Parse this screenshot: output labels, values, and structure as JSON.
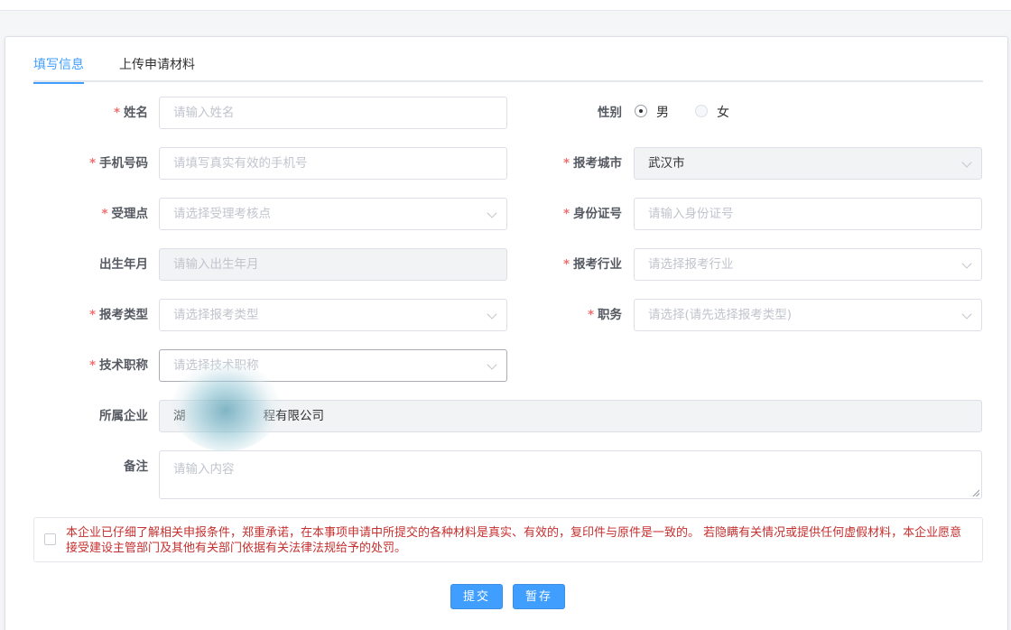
{
  "tabs": [
    {
      "label": "填写信息",
      "active": true
    },
    {
      "label": "上传申请材料",
      "active": false
    }
  ],
  "form": {
    "name": {
      "label": "姓名",
      "required": true,
      "placeholder": "请输入姓名"
    },
    "gender": {
      "label": "性别",
      "options": [
        "男",
        "女"
      ],
      "selected": "男"
    },
    "phone": {
      "label": "手机号码",
      "required": true,
      "placeholder": "请填写真实有效的手机号"
    },
    "city": {
      "label": "报考城市",
      "required": true,
      "value": "武汉市"
    },
    "site": {
      "label": "受理点",
      "required": true,
      "placeholder": "请选择受理考核点"
    },
    "idcard": {
      "label": "身份证号",
      "required": true,
      "placeholder": "请输入身份证号"
    },
    "birth": {
      "label": "出生年月",
      "required": false,
      "placeholder": "请输入出生年月"
    },
    "industry": {
      "label": "报考行业",
      "required": true,
      "placeholder": "请选择报考行业"
    },
    "type": {
      "label": "报考类型",
      "required": true,
      "placeholder": "请选择报考类型"
    },
    "position": {
      "label": "职务",
      "required": true,
      "placeholder": "请选择(请先选择报考类型)"
    },
    "title": {
      "label": "技术职称",
      "required": true,
      "placeholder": "请选择技术职称"
    },
    "company": {
      "label": "所属企业",
      "required": false,
      "value_prefix": "湖",
      "value_suffix": "程有限公司"
    },
    "remark": {
      "label": "备注",
      "required": false,
      "placeholder": "请输入内容"
    }
  },
  "agreement": {
    "text": "本企业已仔细了解相关申报条件，郑重承诺，在本事项申请中所提交的各种材料是真实、有效的，复印件与原件是一致的。 若隐瞒有关情况或提供任何虚假材料，本企业愿意接受建设主管部门及其他有关部门依据有关法律法规给予的处罚。"
  },
  "buttons": {
    "submit": "提交",
    "save": "暂存"
  },
  "colors": {
    "primary": "#409eff",
    "required": "#f56c6c",
    "warning_text": "#c62f2f"
  }
}
